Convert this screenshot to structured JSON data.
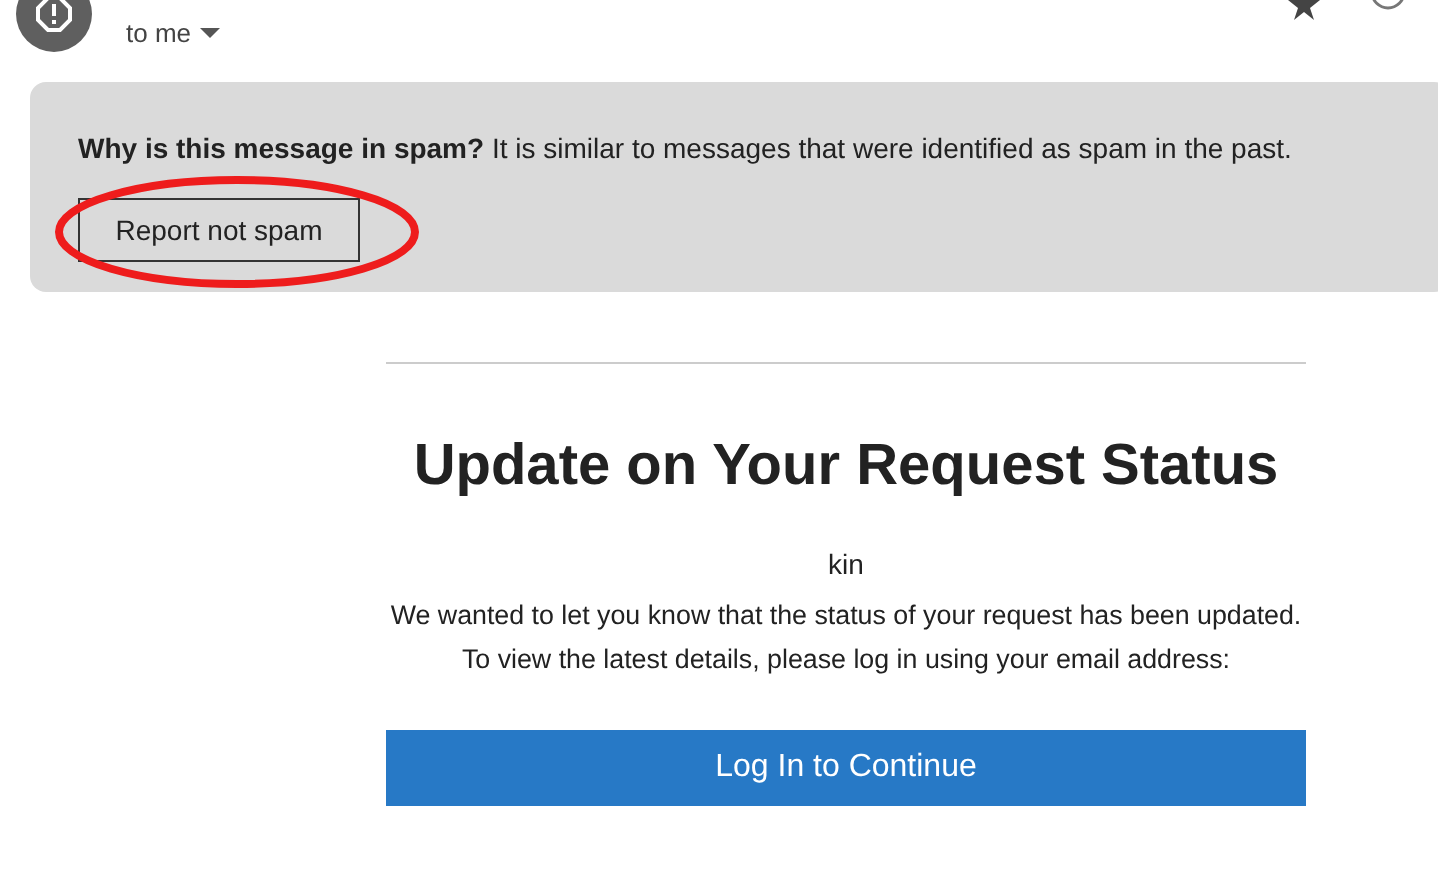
{
  "header": {
    "recipient": "to me"
  },
  "spam_banner": {
    "message": "**Why is this message in spam?** It is similar to messages that were identified as spam in the past.",
    "button": "Report not spam"
  },
  "email": {
    "title": "Update on Your Request Status",
    "greeting": "kin",
    "body": "We wanted to let you know that the status of your request has been updated. To view the latest details, please log in using your email address:",
    "button": "Log In to Continue"
  }
}
